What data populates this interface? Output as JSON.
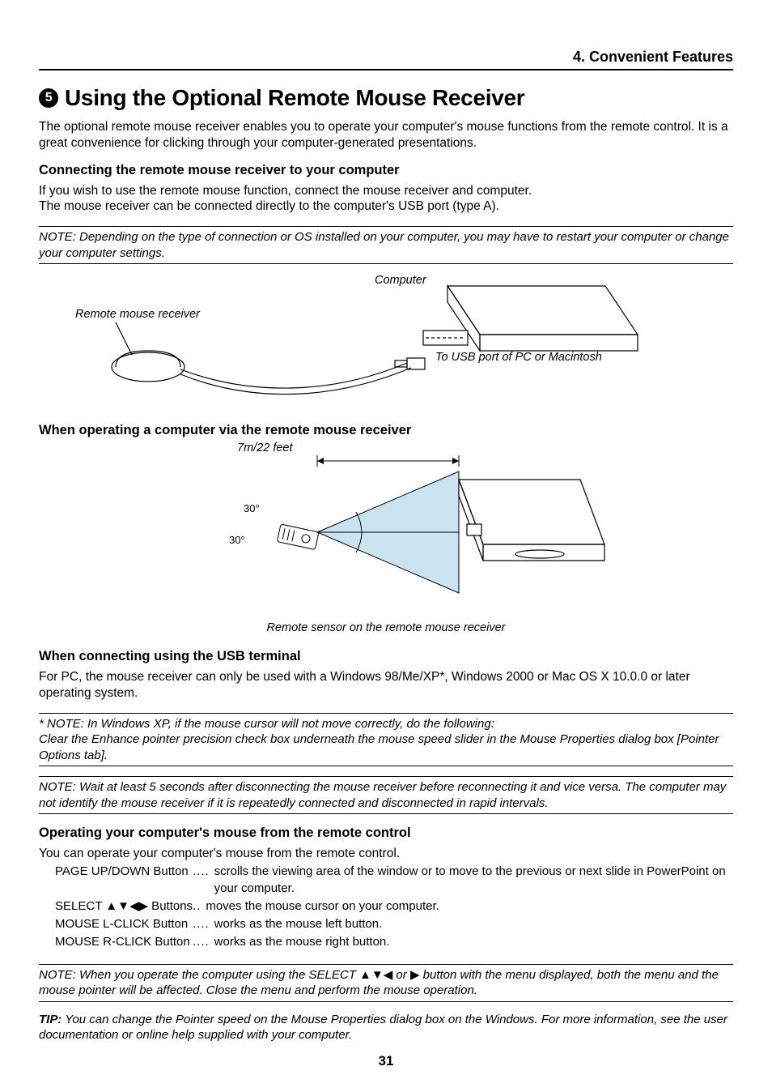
{
  "running_head": "4. Convenient Features",
  "section_number": "5",
  "title": "Using the Optional Remote Mouse Receiver",
  "intro": "The optional remote mouse receiver enables you to operate your computer's mouse functions from the remote control. It is a great convenience for clicking through your computer-generated presentations.",
  "h_connect": "Connecting the remote mouse receiver to your computer",
  "connect_p": "If you wish to use the remote mouse function, connect the mouse receiver and computer.\nThe mouse receiver can be connected directly to the computer's USB port (type A).",
  "note1": "NOTE: Depending on the type of connection or OS installed on your computer, you may have to restart your computer or change your computer settings.",
  "fig1": {
    "receiver": "Remote mouse receiver",
    "computer": "Computer",
    "usb": "To USB port of PC or Macintosh"
  },
  "h_operate": "When operating a computer via the remote mouse receiver",
  "fig2": {
    "range": "7m/22 feet",
    "angle": "30°",
    "caption": "Remote sensor on the remote mouse receiver"
  },
  "h_usb": "When connecting using the USB terminal",
  "usb_p": "For PC, the mouse receiver can only be used with a Windows 98/Me/XP*, Windows 2000 or Mac OS  X 10.0.0 or later operating system.",
  "note2": "* NOTE: In Windows XP, if the mouse cursor will not move correctly, do the following:\nClear the Enhance pointer precision check box underneath the mouse speed slider in the Mouse Properties dialog box [Pointer Options tab].",
  "note3": "NOTE: Wait at least 5 seconds after disconnecting the mouse receiver before reconnecting it and vice versa. The computer may not identify the mouse receiver if it is repeatedly connected and disconnected in rapid intervals.",
  "h_ops": "Operating your computer's mouse from the remote control",
  "ops_p": "You can operate your computer's mouse from the remote control.",
  "dl": {
    "page": {
      "term": "PAGE UP/DOWN Button",
      "def": "scrolls the viewing area of the window or to move to the previous or next slide in PowerPoint on your computer."
    },
    "select": {
      "term_prefix": "SELECT ",
      "term_suffix": " Buttons",
      "def": "moves the mouse cursor on your computer."
    },
    "lclick": {
      "term": "MOUSE L-CLICK Button",
      "def": "works as the mouse left button."
    },
    "rclick": {
      "term": "MOUSE R-CLICK Button",
      "def": "works as the mouse right button."
    }
  },
  "note4_prefix": "NOTE: When you operate the computer using the SELECT ",
  "note4_mid": " or ",
  "note4_suffix": " button with the menu displayed, both the menu and the mouse pointer will be affected. Close the menu and perform the mouse operation.",
  "tip_label": "TIP:",
  "tip_text": " You can change the Pointer speed on the Mouse Properties dialog box on the Windows. For more information, see the user documentation or online help supplied with your computer.",
  "page_number": "31"
}
